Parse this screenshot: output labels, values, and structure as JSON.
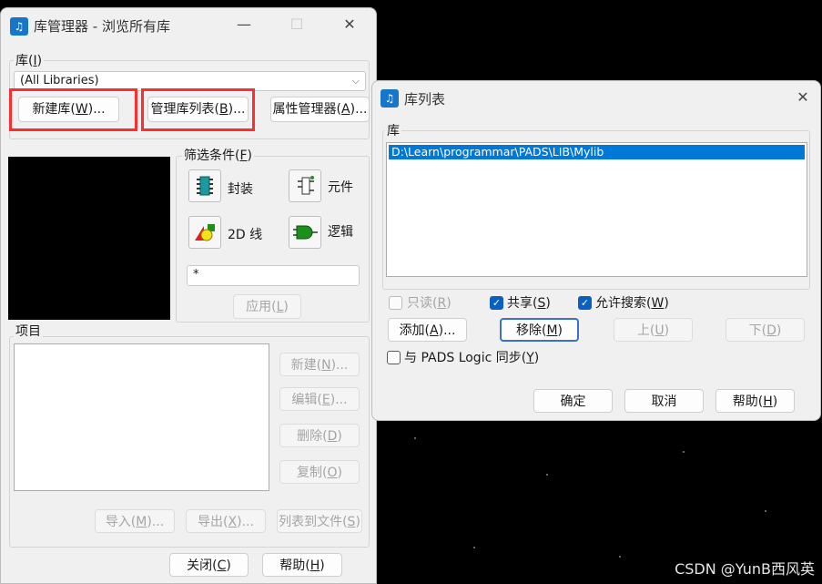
{
  "manager": {
    "title": "库管理器 - 浏览所有库",
    "icon": "library-app-icon",
    "window_controls": {
      "minimize": "—",
      "maximize": "☐",
      "close": "✕"
    },
    "library_group": {
      "label": "库(",
      "hotkey": "I",
      "label_end": ")"
    },
    "library_select": {
      "value": "(All Libraries)"
    },
    "buttons": {
      "new_library": {
        "label": "新建库(",
        "hotkey": "W",
        "end": ")..."
      },
      "manage_list": {
        "label": "管理库列表(",
        "hotkey": "B",
        "end": ")..."
      },
      "attr_manager": {
        "label": "属性管理器(",
        "hotkey": "A",
        "end": ")..."
      }
    },
    "filter": {
      "label": "筛选条件(",
      "hotkey": "F",
      "label_end": ")",
      "decal": "封装",
      "part": "元件",
      "line2d": "2D 线",
      "logic": "逻辑",
      "pattern": "*",
      "apply": {
        "label": "应用(",
        "hotkey": "L",
        "end": ")"
      }
    },
    "items_group": {
      "label": "项目"
    },
    "item_buttons": {
      "new": {
        "label": "新建(",
        "hotkey": "N",
        "end": ")..."
      },
      "edit": {
        "label": "编辑(",
        "hotkey": "E",
        "end": ")..."
      },
      "delete": {
        "label": "删除(",
        "hotkey": "D",
        "end": ")"
      },
      "copy": {
        "label": "复制(",
        "hotkey": "O",
        "end": ")"
      }
    },
    "bottom_buttons": {
      "import": {
        "label": "导入(",
        "hotkey": "M",
        "end": ")..."
      },
      "export": {
        "label": "导出(",
        "hotkey": "X",
        "end": ")..."
      },
      "list_to_file": {
        "label": "列表到文件(",
        "hotkey": "S",
        "end": ")"
      }
    },
    "close": {
      "label": "关闭(",
      "hotkey": "C",
      "end": ")"
    },
    "help": {
      "label": "帮助(",
      "hotkey": "H",
      "end": ")"
    },
    "colors": {
      "highlight_box": "#ff2e2e",
      "window_bg": "#f0f0f0"
    }
  },
  "liblist": {
    "title": "库列表",
    "close": "✕",
    "group_label": "库",
    "entries": [
      "D:\\Learn\\programmar\\PADS\\LIB\\Mylib"
    ],
    "checkboxes": {
      "readonly": {
        "label": "只读(",
        "hotkey": "R",
        "end": ")",
        "checked": false,
        "enabled": false
      },
      "shared": {
        "label": "共享(",
        "hotkey": "S",
        "end": ")",
        "checked": true,
        "enabled": true
      },
      "allow_search": {
        "label": "允许搜索(",
        "hotkey": "W",
        "end": ")",
        "checked": true,
        "enabled": true
      },
      "sync": {
        "label": "与 PADS Logic 同步(",
        "hotkey": "Y",
        "end": ")",
        "checked": false,
        "enabled": true
      }
    },
    "buttons": {
      "add": {
        "label": "添加(",
        "hotkey": "A",
        "end": ")..."
      },
      "remove": {
        "label": "移除(",
        "hotkey": "M",
        "end": ")"
      },
      "up": {
        "label": "上(",
        "hotkey": "U",
        "end": ")"
      },
      "down": {
        "label": "下(",
        "hotkey": "D",
        "end": ")"
      },
      "ok": {
        "label": "确定"
      },
      "cancel": {
        "label": "取消"
      },
      "help": {
        "label": "帮助(",
        "hotkey": "H",
        "end": ")"
      }
    },
    "colors": {
      "selection": "#0078d7",
      "checkbox_on": "#0a5fbf"
    }
  },
  "watermark": "CSDN @YunB西风英"
}
